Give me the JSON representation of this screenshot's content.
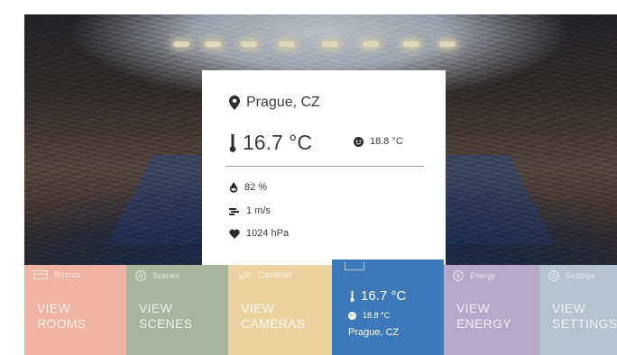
{
  "weather_card": {
    "location": "Prague, CZ",
    "temperature": "16.7 °C",
    "feels_like": "18.8 °C",
    "humidity": "82 %",
    "wind": "1 m/s",
    "pressure": "1024 hPa"
  },
  "tiles": [
    {
      "small_label": "Rooms",
      "big_label": "VIEW\nROOMS",
      "icon": "rooms-icon",
      "color": "#efb3a3"
    },
    {
      "small_label": "Scenes",
      "big_label": "VIEW\nSCENES",
      "icon": "scenes-icon",
      "color": "#a9b49d"
    },
    {
      "small_label": "Cameras",
      "big_label": "VIEW\nCAMERAS",
      "icon": "cameras-icon",
      "color": "#ead3a0"
    },
    {
      "small_label": "Energy",
      "big_label": "VIEW\nENERGY",
      "icon": "energy-icon",
      "color": "#b5a8c8"
    },
    {
      "small_label": "Settings",
      "big_label": "VIEW\nSETTINGS",
      "icon": "settings-icon",
      "color": "#b3c3cf"
    }
  ],
  "weather_tile": {
    "temperature": "16.7 °C",
    "feels_like": "18.8 °C",
    "city": "Prague, CZ",
    "color": "#3d79b8"
  }
}
